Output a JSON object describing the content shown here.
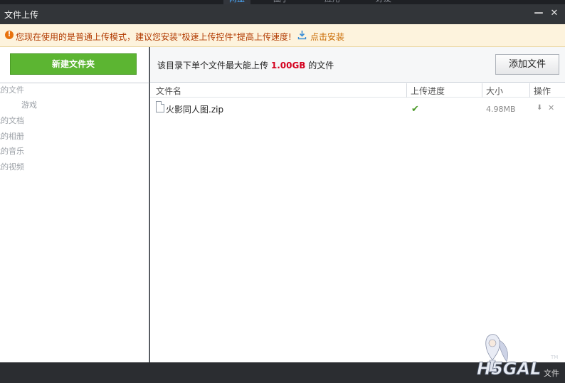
{
  "top_nav": {
    "tabs": [
      {
        "label": "网盘",
        "active": true
      },
      {
        "label": "圈子",
        "active": false
      },
      {
        "label": "应用",
        "active": false
      },
      {
        "label": "好友",
        "active": false
      }
    ]
  },
  "window": {
    "title": "文件上传",
    "minimize_icon": "minimize-icon",
    "close_icon": "close-icon"
  },
  "notice": {
    "text": "您现在使用的是普通上传模式，建议您安装\"极速上传控件\"提高上传速度!",
    "install_label": "点击安装",
    "accent_color": "#b13a00"
  },
  "sidebar": {
    "new_folder_label": "新建文件夹",
    "tree": [
      {
        "label": "我的文件"
      },
      {
        "label": "游戏"
      },
      {
        "label": "我的文档"
      },
      {
        "label": "我的相册"
      },
      {
        "label": "我的音乐"
      },
      {
        "label": "我的视频"
      }
    ]
  },
  "main": {
    "info_prefix": "该目录下单个文件最大能上传",
    "info_size": "1.00GB",
    "info_suffix": "的文件",
    "add_file_label": "添加文件",
    "columns": {
      "name": "文件名",
      "progress": "上传进度",
      "size": "大小",
      "actions": "操作"
    },
    "files": [
      {
        "name": "火影同人图.zip",
        "status": "complete",
        "size": "4.98MB"
      }
    ]
  },
  "bottom": {
    "label": "文件"
  },
  "watermark": {
    "text": "H5GAL",
    "tm": "TM"
  }
}
